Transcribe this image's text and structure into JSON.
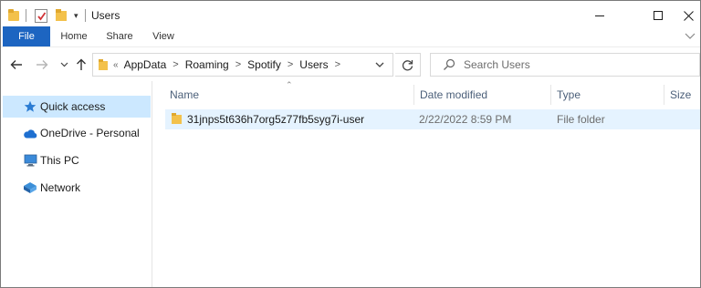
{
  "window": {
    "title": "Users"
  },
  "ribbon": {
    "tabs": [
      "File",
      "Home",
      "Share",
      "View"
    ]
  },
  "address": {
    "overflow_glyph": "«",
    "crumbs": [
      "AppData",
      "Roaming",
      "Spotify",
      "Users"
    ]
  },
  "search": {
    "placeholder": "Search Users"
  },
  "nav_pane": {
    "items": [
      {
        "label": "Quick access",
        "icon": "star-icon",
        "selected": true
      },
      {
        "label": "OneDrive - Personal",
        "icon": "cloud-icon",
        "selected": false
      },
      {
        "label": "This PC",
        "icon": "computer-icon",
        "selected": false
      },
      {
        "label": "Network",
        "icon": "network-icon",
        "selected": false
      }
    ]
  },
  "file_list": {
    "columns": [
      "Name",
      "Date modified",
      "Type",
      "Size"
    ],
    "rows": [
      {
        "name": "31jnps5t636h7org5z77fb5syg7i-user",
        "date_modified": "2/22/2022 8:59 PM",
        "type": "File folder",
        "size": ""
      }
    ]
  },
  "colors": {
    "file_tab": "#1d65c1",
    "selection": "#cce8ff",
    "row_hover": "#e5f3ff",
    "folder": "#f3c14b"
  }
}
